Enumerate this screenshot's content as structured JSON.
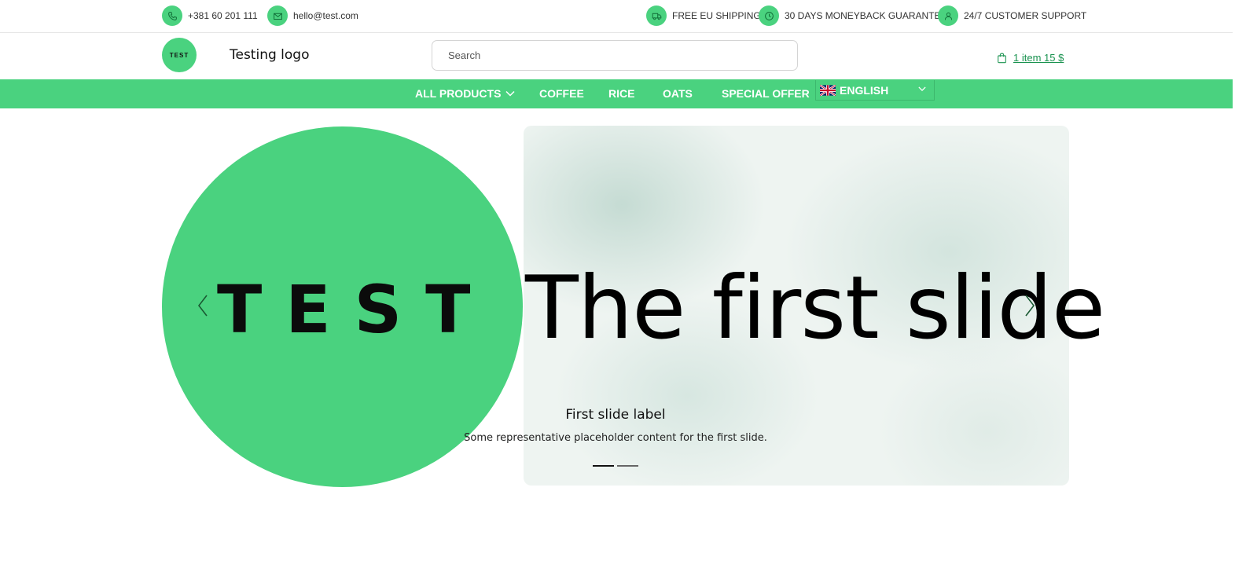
{
  "topbar": {
    "phone": "+381 60 201 111",
    "email": "hello@test.com",
    "shipping": "FREE EU SHIPPING",
    "guarantee": "30 DAYS MONEYBACK GUARANTEE",
    "support": "24/7 CUSTOMER SUPPORT"
  },
  "header": {
    "logo_mark": "TEST",
    "logo_text": "Testing logo",
    "search_placeholder": "Search",
    "cart_label": "1 item 15 $"
  },
  "nav": {
    "items": [
      "ALL PRODUCTS",
      "COFFEE",
      "RICE",
      "OATS",
      "SPECIAL OFFER"
    ],
    "language": "ENGLISH"
  },
  "carousel": {
    "logo_word": "TEST",
    "big_text": "The first slide",
    "caption_title": "First slide label",
    "caption_text": "Some representative placeholder content for the first slide.",
    "active_indicator": 1,
    "indicator_count": 2
  },
  "colors": {
    "accent": "#4ad27f",
    "link": "#19924f",
    "slide_bg": "#eef4f1"
  },
  "icons": [
    "phone-icon",
    "mail-icon",
    "truck-icon",
    "clock-icon",
    "user-icon",
    "shopping-bag-icon",
    "chevron-down-icon",
    "uk-flag-icon",
    "chevron-left-icon",
    "chevron-right-icon"
  ]
}
